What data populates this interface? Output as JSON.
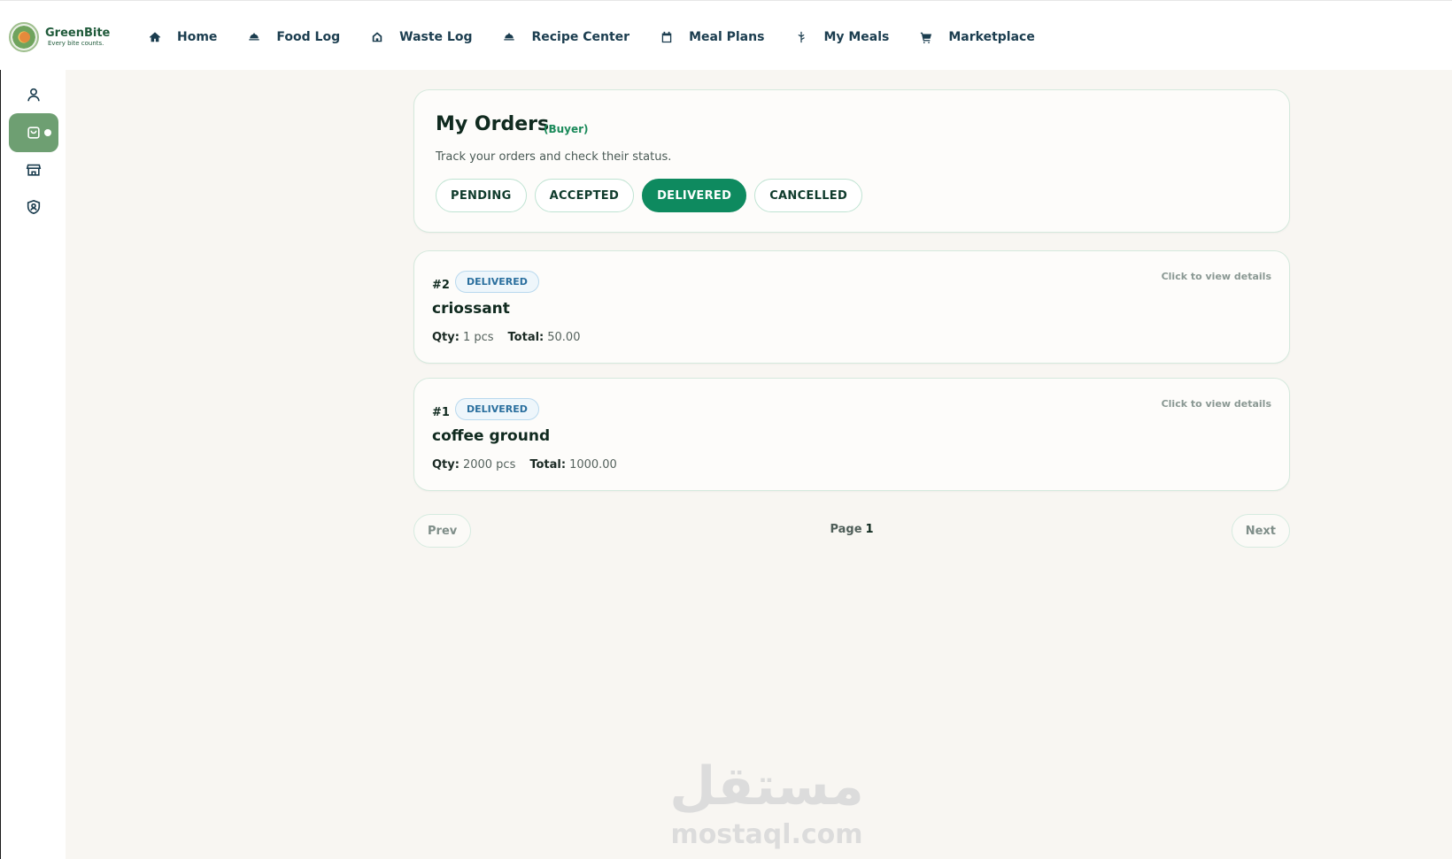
{
  "brand": {
    "name": "GreenBite",
    "tagline": "Every bite counts."
  },
  "nav": [
    {
      "label": "Home",
      "icon": "home-icon"
    },
    {
      "label": "Food Log",
      "icon": "cloche-icon"
    },
    {
      "label": "Waste Log",
      "icon": "house-icon"
    },
    {
      "label": "Recipe Center",
      "icon": "cloche-icon"
    },
    {
      "label": "Meal Plans",
      "icon": "calendar-icon"
    },
    {
      "label": "My Meals",
      "icon": "wheat-icon"
    },
    {
      "label": "Marketplace",
      "icon": "cart-icon"
    }
  ],
  "sidebar": [
    {
      "icon": "user-icon",
      "active": false
    },
    {
      "icon": "shopping-bag-icon",
      "active": true
    },
    {
      "icon": "store-icon",
      "active": false
    },
    {
      "icon": "shield-user-icon",
      "active": false
    }
  ],
  "header": {
    "title": "My Orders",
    "role": "(Buyer)",
    "subtitle": "Track your orders and check their status.",
    "filters": [
      {
        "label": "PENDING",
        "active": false
      },
      {
        "label": "ACCEPTED",
        "active": false
      },
      {
        "label": "DELIVERED",
        "active": true
      },
      {
        "label": "CANCELLED",
        "active": false
      }
    ]
  },
  "orders": [
    {
      "id": "#2",
      "status": "DELIVERED",
      "name": "criossant",
      "qty_label": "Qty:",
      "qty": "1 pcs",
      "total_label": "Total:",
      "total": "50.00",
      "hint": "Click to view details"
    },
    {
      "id": "#1",
      "status": "DELIVERED",
      "name": "coffee ground",
      "qty_label": "Qty:",
      "qty": "2000 pcs",
      "total_label": "Total:",
      "total": "1000.00",
      "hint": "Click to view details"
    }
  ],
  "pager": {
    "prev": "Prev",
    "next": "Next",
    "page_label": "Page",
    "page": "1"
  },
  "watermark": {
    "arabic": "مستقل",
    "latin": "mostaql.com"
  },
  "colors": {
    "accent": "#0e8a5f",
    "sidebar_active": "#6e9f72",
    "background": "#f8f6f2",
    "badge_text": "#2a6f9e"
  }
}
